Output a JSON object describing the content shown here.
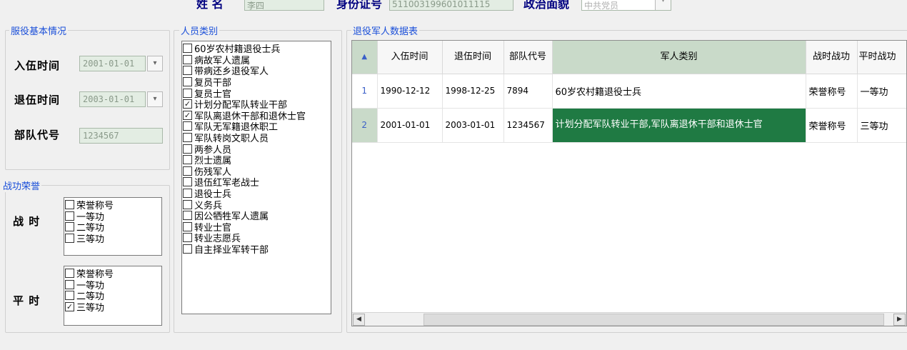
{
  "top": {
    "name_label": "姓 名",
    "name_value": "李四",
    "id_label": "身份证号",
    "id_value": "511003199601011115",
    "politics_label": "政治面貌",
    "politics_value": "中共党员"
  },
  "service": {
    "title": "服役基本情况",
    "enlist_label": "入伍时间",
    "enlist_value": "2001-01-01",
    "discharge_label": "退伍时间",
    "discharge_value": "2003-01-01",
    "unit_label": "部队代号",
    "unit_value": "1234567"
  },
  "merit": {
    "title": "战功荣誉",
    "war_label": "战 时",
    "peace_label": "平 时",
    "war_items": [
      {
        "label": "荣誉称号",
        "checked": false
      },
      {
        "label": "一等功",
        "checked": false
      },
      {
        "label": "二等功",
        "checked": false
      },
      {
        "label": "三等功",
        "checked": false
      }
    ],
    "peace_items": [
      {
        "label": "荣誉称号",
        "checked": false
      },
      {
        "label": "一等功",
        "checked": false
      },
      {
        "label": "二等功",
        "checked": false
      },
      {
        "label": "三等功",
        "checked": true
      }
    ]
  },
  "personnel": {
    "title": "人员类别",
    "items": [
      {
        "label": "60岁农村籍退役士兵",
        "checked": false
      },
      {
        "label": "病故军人遗属",
        "checked": false
      },
      {
        "label": "带病还乡退役军人",
        "checked": false
      },
      {
        "label": "复员干部",
        "checked": false
      },
      {
        "label": "复员士官",
        "checked": false
      },
      {
        "label": "计划分配军队转业干部",
        "checked": true
      },
      {
        "label": "军队离退休干部和退休士官",
        "checked": true
      },
      {
        "label": "军队无军籍退休职工",
        "checked": false
      },
      {
        "label": "军队转岗文职人员",
        "checked": false
      },
      {
        "label": "两参人员",
        "checked": false
      },
      {
        "label": "烈士遗属",
        "checked": false
      },
      {
        "label": "伤残军人",
        "checked": false
      },
      {
        "label": "退伍红军老战士",
        "checked": false
      },
      {
        "label": "退役士兵",
        "checked": false
      },
      {
        "label": "义务兵",
        "checked": false
      },
      {
        "label": "因公牺牲军人遗属",
        "checked": false
      },
      {
        "label": "转业士官",
        "checked": false
      },
      {
        "label": "转业志愿兵",
        "checked": false
      },
      {
        "label": "自主择业军转干部",
        "checked": false
      }
    ]
  },
  "table": {
    "title": "退役军人数据表",
    "columns": [
      "入伍时间",
      "退伍时间",
      "部队代号",
      "军人类别",
      "战时战功",
      "平时战功"
    ],
    "rows": [
      {
        "no": "1",
        "enlist": "1990-12-12",
        "discharge": "1998-12-25",
        "unit": "7894",
        "category": "60岁农村籍退役士兵",
        "war": "荣誉称号",
        "peace": "一等功"
      },
      {
        "no": "2",
        "enlist": "2001-01-01",
        "discharge": "2003-01-01",
        "unit": "1234567",
        "category": "计划分配军队转业干部,军队离退休干部和退休士官",
        "war": "荣誉称号",
        "peace": "三等功"
      }
    ]
  }
}
